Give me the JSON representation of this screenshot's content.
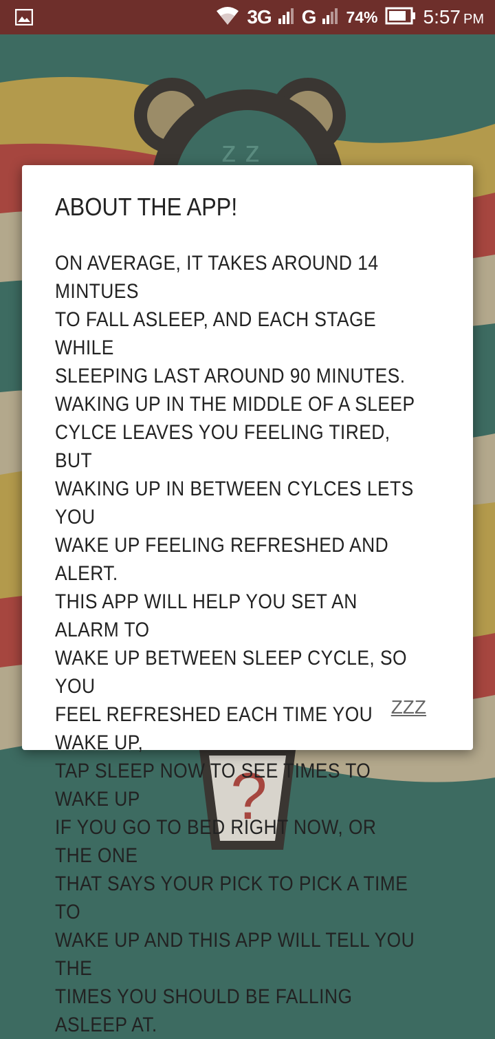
{
  "status_bar": {
    "network_3g": "3G",
    "network_g": "G",
    "battery_percent": "74%",
    "time": "5:57",
    "ampm": "PM",
    "icons": [
      "image-icon",
      "wifi-icon",
      "signal-icon",
      "battery-icon"
    ]
  },
  "dialog": {
    "title": "ABOUT THE APP!",
    "body_lines": [
      "ON AVERAGE, IT TAKES AROUND 14 MINTUES",
      "TO FALL ASLEEP, AND EACH STAGE WHILE",
      "SLEEPING LAST AROUND 90 MINUTES.",
      "WAKING UP IN THE MIDDLE OF A SLEEP",
      "CYLCE LEAVES YOU FEELING TIRED, BUT",
      "WAKING UP IN BETWEEN CYLCES LETS YOU",
      "WAKE UP FEELING REFRESHED AND ALERT.",
      "THIS APP WILL HELP YOU SET AN ALARM TO",
      "WAKE UP BETWEEN SLEEP CYCLE, SO YOU",
      "FEEL REFRESHED EACH TIME YOU WAKE UP,",
      "TAP SLEEP NOW TO SEE TIMES TO WAKE UP",
      "IF YOU GO TO BED RIGHT NOW, OR THE ONE",
      "THAT SAYS YOUR PICK TO PICK A TIME TO",
      "WAKE UP AND THIS APP WILL TELL YOU THE",
      "TIMES YOU SHOULD BE FALLING ASLEEP AT."
    ],
    "button_label": "ZZZ"
  },
  "background": {
    "help_glyph": "?",
    "colors": {
      "teal": "#3d6b61",
      "mustard": "#b39a4c",
      "red": "#a6463f",
      "beige": "#b3a88c",
      "bear": "#3a3632",
      "ear_inner": "#9b8c68",
      "status_bar": "#6e2f2b"
    }
  }
}
